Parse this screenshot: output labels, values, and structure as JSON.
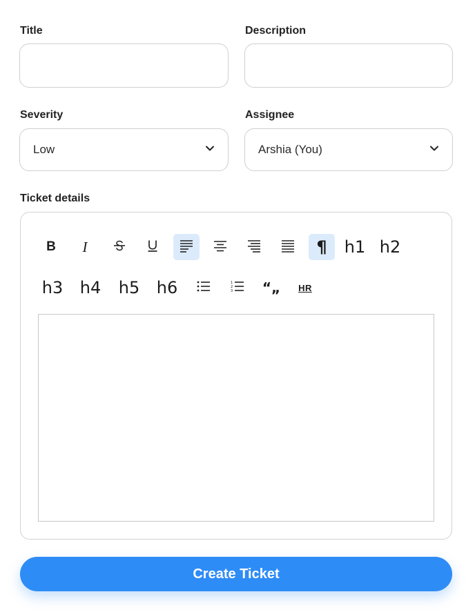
{
  "form": {
    "title": {
      "label": "Title",
      "value": ""
    },
    "description": {
      "label": "Description",
      "value": ""
    },
    "severity": {
      "label": "Severity",
      "selected": "Low"
    },
    "assignee": {
      "label": "Assignee",
      "selected": "Arshia (You)"
    },
    "details": {
      "label": "Ticket details",
      "content": ""
    }
  },
  "toolbar": {
    "bold": "B",
    "italic": "I",
    "paragraph": "¶",
    "h1": "h1",
    "h2": "h2",
    "h3": "h3",
    "h4": "h4",
    "h5": "h5",
    "h6": "h6",
    "quote": "“„",
    "hr": "HR",
    "active_buttons": [
      "align-left",
      "paragraph"
    ]
  },
  "submit_label": "Create Ticket",
  "colors": {
    "accent": "#2e8cf6",
    "active_bg": "#dcebfb",
    "border": "#cfcfcf"
  }
}
